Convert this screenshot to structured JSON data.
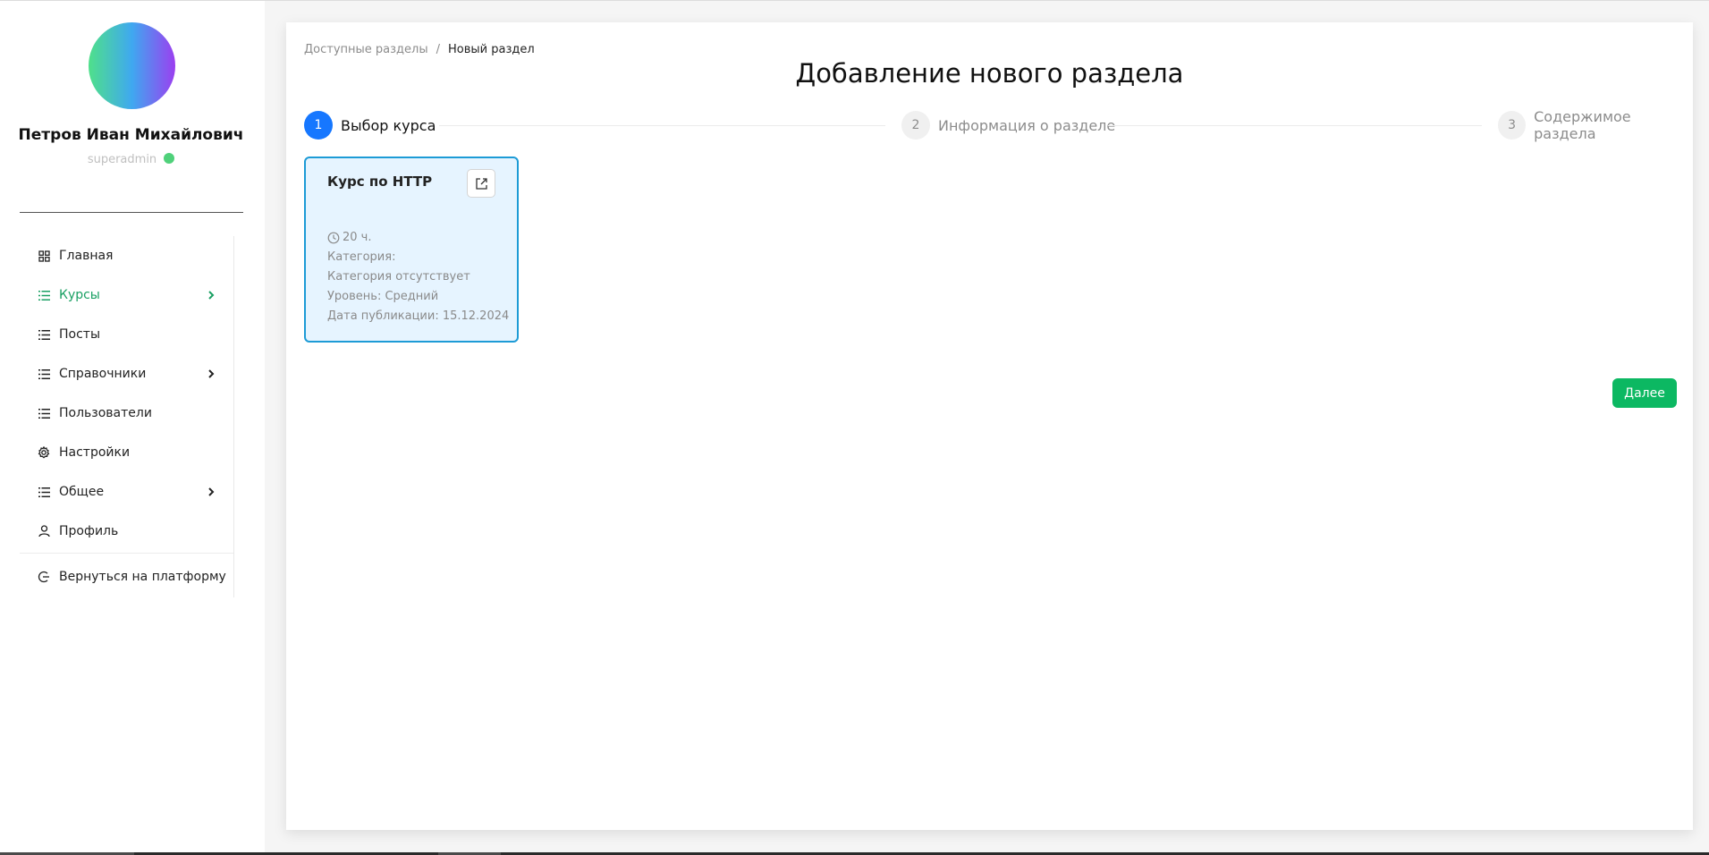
{
  "user": {
    "name": "Петров Иван Михайлович",
    "role": "superadmin"
  },
  "sidebar": {
    "items": [
      {
        "label": "Главная",
        "icon": "grid-icon",
        "active": false,
        "has_submenu": false
      },
      {
        "label": "Курсы",
        "icon": "list-icon",
        "active": true,
        "has_submenu": true
      },
      {
        "label": "Посты",
        "icon": "list-icon",
        "active": false,
        "has_submenu": false
      },
      {
        "label": "Справочники",
        "icon": "list-icon",
        "active": false,
        "has_submenu": true
      },
      {
        "label": "Пользователи",
        "icon": "list-icon",
        "active": false,
        "has_submenu": false
      },
      {
        "label": "Настройки",
        "icon": "gear-icon",
        "active": false,
        "has_submenu": false
      },
      {
        "label": "Общее",
        "icon": "list-icon",
        "active": false,
        "has_submenu": true
      },
      {
        "label": "Профиль",
        "icon": "user-icon",
        "active": false,
        "has_submenu": false
      }
    ],
    "back_label": "Вернуться на платформу",
    "back_icon": "logout-icon"
  },
  "breadcrumb": {
    "parent": "Доступные разделы",
    "separator": "/",
    "current": "Новый раздел"
  },
  "page_title": "Добавление нового раздела",
  "steps": [
    {
      "number": "1",
      "label": "Выбор курса",
      "state": "active"
    },
    {
      "number": "2",
      "label": "Информация о разделе",
      "state": "inactive"
    },
    {
      "number": "3",
      "label": "Содержимое раздела",
      "state": "inactive"
    }
  ],
  "course_card": {
    "title": "Курс по HTTP",
    "duration": "20 ч.",
    "category_label": "Категория:",
    "category_value": "Категория отсутствует",
    "level": "Уровень: Средний",
    "published": "Дата публикации: 15.12.2024",
    "open_icon": "external-link-icon",
    "duration_icon": "clock-icon"
  },
  "next_button": "Далее",
  "colors": {
    "accent_green": "#0cb862",
    "active_menu": "#1aa063",
    "step_active": "#1677ff",
    "card_border": "#1d9bd6",
    "card_bg": "#e6f4ff"
  }
}
